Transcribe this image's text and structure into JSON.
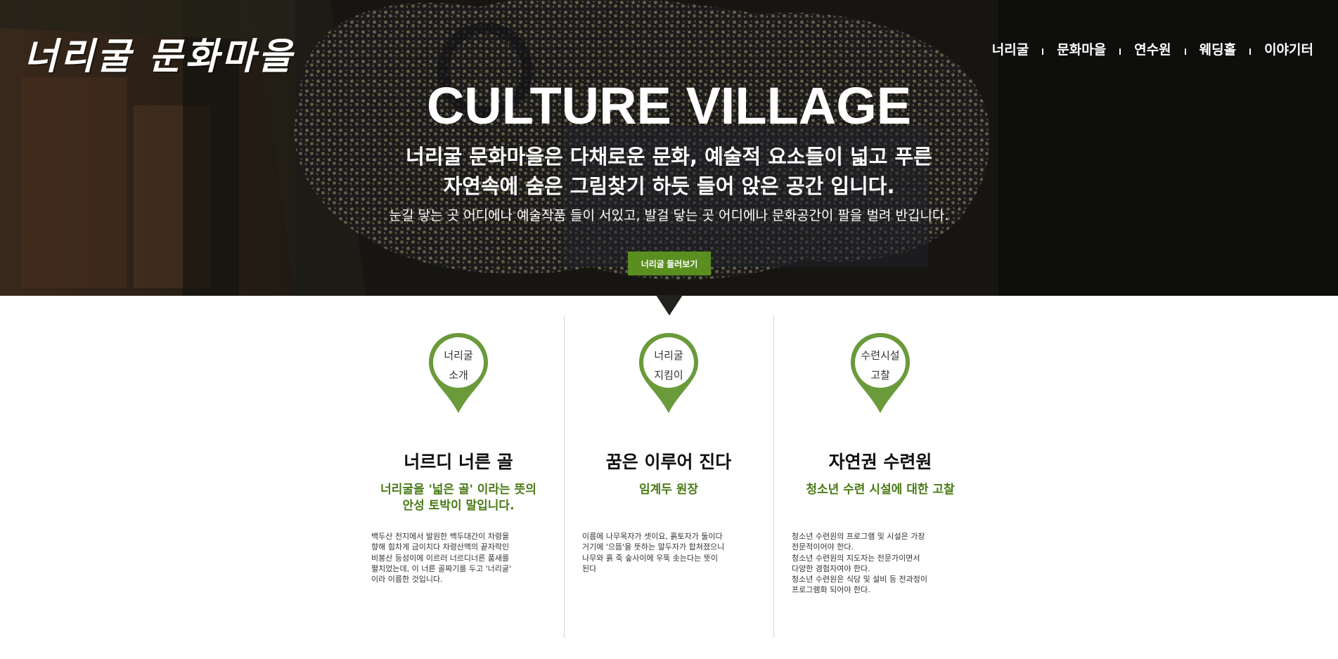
{
  "logo": {
    "text": "너리굴 문화마을"
  },
  "nav": {
    "items": [
      "너리굴",
      "문화마을",
      "연수원",
      "웨딩홀",
      "이야기터"
    ]
  },
  "hero": {
    "title": "CULTURE VILLAGE",
    "subtitle_line1": "너리굴 문화마을은 다채로운 문화, 예술적 요소들이 넓고 푸른",
    "subtitle_line2": "자연속에 숨은 그림찾기 하듯 들어 앉은 공간 입니다.",
    "description": "눈길 닿는 곳 어디에나 예술작품 들이 서있고, 발걸 닿는 곳 어디에나 문화공간이 팔을 벌려 반깁니다.",
    "button_label": "너리굴 둘러보기"
  },
  "columns": [
    {
      "pin_line1": "너리굴",
      "pin_line2": "소개",
      "title": "너르디 너른 골",
      "subtitle": "너리굴을 '넓은 골' 이라는 뜻의\n안성 토박이 말입니다.",
      "body": "백두산 전지에서 발원한 백두대간이 차령을\n향해 힘차게 금이치다 차령산맥의 끝자락인\n비봉산 등성이에 이르러 너르디너른 품새를\n펼치었는데, 이 너른 골짜기를 두고 '너리굴'\n이라 이름한 것입니다."
    },
    {
      "pin_line1": "너리굴",
      "pin_line2": "지킴이",
      "title": "꿈은 이루어 진다",
      "subtitle": "임계두 원장",
      "body": "이름에 나무목자가 셋이요, 흙토자가 둘이다\n거기에 '으뜸'을 뜻하는 말두자가 합쳐졌으니\n나무와 흙 죽 숲사이에 우뚝 솟는다는 뜻이\n된다"
    },
    {
      "pin_line1": "수련시설",
      "pin_line2": "고찰",
      "title": "자연권 수련원",
      "subtitle": "청소년 수련 시설에 대한 고찰",
      "body": "청소년 수련원의 프로그램 및 시설은 가장\n전문적이어야 한다.\n청소년 수련원의 지도자는 전문가이면서\n다양한 경험자여야 한다.\n청소년 수련원은 식당 및 설비 등 전과정이\n프로그램화 되어야 한다."
    }
  ],
  "colors": {
    "accent": "#5a8e1e",
    "pin": "#6a9a3a",
    "subtitle": "#4a7a16"
  }
}
